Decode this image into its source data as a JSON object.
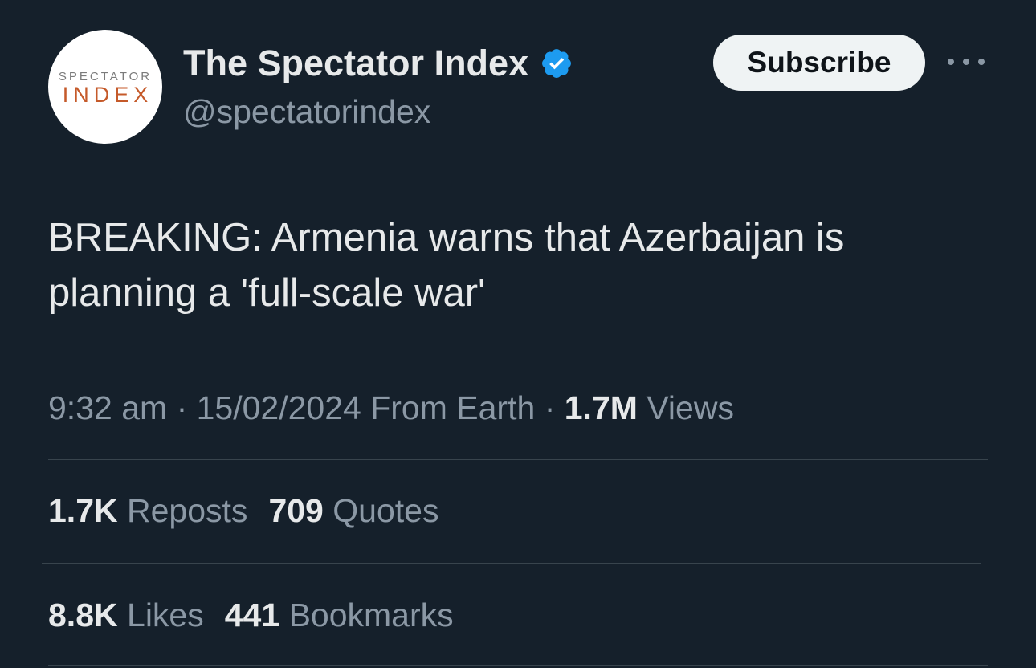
{
  "author": {
    "avatar_line1": "SPECTATOR",
    "avatar_line2": "INDEX",
    "display_name": "The Spectator Index",
    "handle": "@spectatorindex",
    "verified_icon": "verified-badge-icon",
    "verified_color": "#1d9bf0"
  },
  "actions": {
    "subscribe_label": "Subscribe",
    "more_icon": "more-options-icon"
  },
  "tweet": {
    "text": "BREAKING: Armenia warns that Azerbaijan is planning a 'full-scale war'",
    "time": "9:32 am",
    "separator": "·",
    "date": "15/02/2024",
    "source": "From Earth",
    "views_count": "1.7M",
    "views_label": "Views"
  },
  "stats": {
    "reposts_count": "1.7K",
    "reposts_label": "Reposts",
    "quotes_count": "709",
    "quotes_label": "Quotes",
    "likes_count": "8.8K",
    "likes_label": "Likes",
    "bookmarks_count": "441",
    "bookmarks_label": "Bookmarks"
  },
  "colors": {
    "background": "#15202b",
    "primary_text": "#e7e9ea",
    "secondary_text": "#8b98a5",
    "divider": "#38444d",
    "avatar_accent": "#c55a2a"
  }
}
